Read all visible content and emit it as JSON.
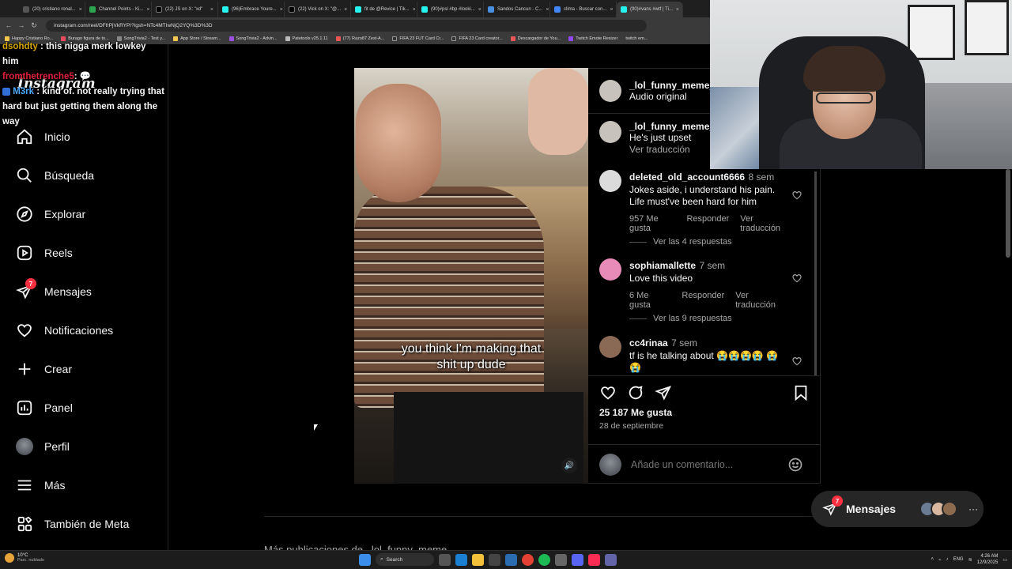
{
  "browser": {
    "tabs": [
      {
        "label": "(20) cristiano ronal..."
      },
      {
        "label": "Channel Points - Ki..."
      },
      {
        "label": "(22) JS on X: \"xd\""
      },
      {
        "label": "(96)Embrace Youre..."
      },
      {
        "label": "(22) Vick on X: \"@..."
      },
      {
        "label": "fit de @Revice | Tik..."
      },
      {
        "label": "(90)#psl #bp #looki..."
      },
      {
        "label": "Sandos Cancun - C..."
      },
      {
        "label": "clima - Buscar con..."
      },
      {
        "label": "(90)#vans #wtf | Ti..."
      }
    ],
    "url": "instagram.com/reel/DFfrPjVkRYP/?igsh=NTc4MTIwNjQ2YQ%3D%3D",
    "bookmarks": [
      "Happy Cristiano Ro...",
      "Burago figura de to...",
      "SongTrivia2 - Test y...",
      "App Store / Stream...",
      "SongTrivia2 - Advin...",
      "Patetools v25.1.11",
      "(77) Razo87 Zest-A...",
      "FIFA 23 FUT Card Cr...",
      "FIFA 23 Card creator...",
      "Descargador de You...",
      "Twitch Emote Resizer",
      "twitch em..."
    ]
  },
  "chat": {
    "line1_user": "dsohdty",
    "line1_text": ": this nigga merk lowkey him",
    "line2_user": "fromthetrenche5",
    "line2_text": ":",
    "line3_user": "M3rk",
    "line3_text": ": kind of. not really trying that hard but just getting them along the way"
  },
  "instagram": {
    "logo": "Instagram",
    "nav": {
      "inicio": "Inicio",
      "busqueda": "Búsqueda",
      "explorar": "Explorar",
      "reels": "Reels",
      "mensajes": "Mensajes",
      "mensajes_badge": "7",
      "notificaciones": "Notificaciones",
      "crear": "Crear",
      "panel": "Panel",
      "perfil": "Perfil",
      "mas": "Más",
      "meta": "También de Meta"
    },
    "post": {
      "caption_line1": "you think I'm making that",
      "caption_line2": "shit up dude",
      "author": "_lol_funny_meme_",
      "audio": "Audio original",
      "author_comment_user": "_lol_funny_meme_x",
      "author_comment_text": "He's just upset",
      "see_translation": "Ver traducción",
      "comments": [
        {
          "user": "deleted_old_account6666",
          "time": "8 sem",
          "text": "Jokes aside, i understand his pain. Life must've been hard for him",
          "likes": "957 Me gusta",
          "reply": "Responder",
          "translate": "Ver traducción",
          "replies": "Ver las 4 respuestas",
          "avatar_color": "#dbdbdb"
        },
        {
          "user": "sophiamallette",
          "time": "7 sem",
          "text": "Love this video",
          "likes": "6 Me gusta",
          "reply": "Responder",
          "translate": "Ver traducción",
          "replies": "Ver las 9 respuestas",
          "avatar_color": "#e88bb8"
        },
        {
          "user": "cc4rinaa",
          "time": "7 sem",
          "text": "tf is he talking about 😭😭😭😭 😭😭",
          "avatar_color": "#8a6a55"
        }
      ],
      "likes_count": "25 187 Me gusta",
      "date": "28 de septiembre",
      "comment_placeholder": "Añade un comentario...",
      "more_from": "Más publicaciones de _lol_funny_meme_"
    },
    "messages_pill": {
      "label": "Mensajes",
      "badge": "7"
    }
  },
  "taskbar": {
    "weather_temp": "10°C",
    "weather_desc": "Parc. nublado",
    "search": "Search",
    "lang": "ENG",
    "time": "4:26 AM",
    "date": "12/9/2025"
  },
  "colors": {
    "background": "#000000",
    "notification": "#ff3040",
    "secondary_text": "#a8a8a8",
    "border": "#262626"
  }
}
